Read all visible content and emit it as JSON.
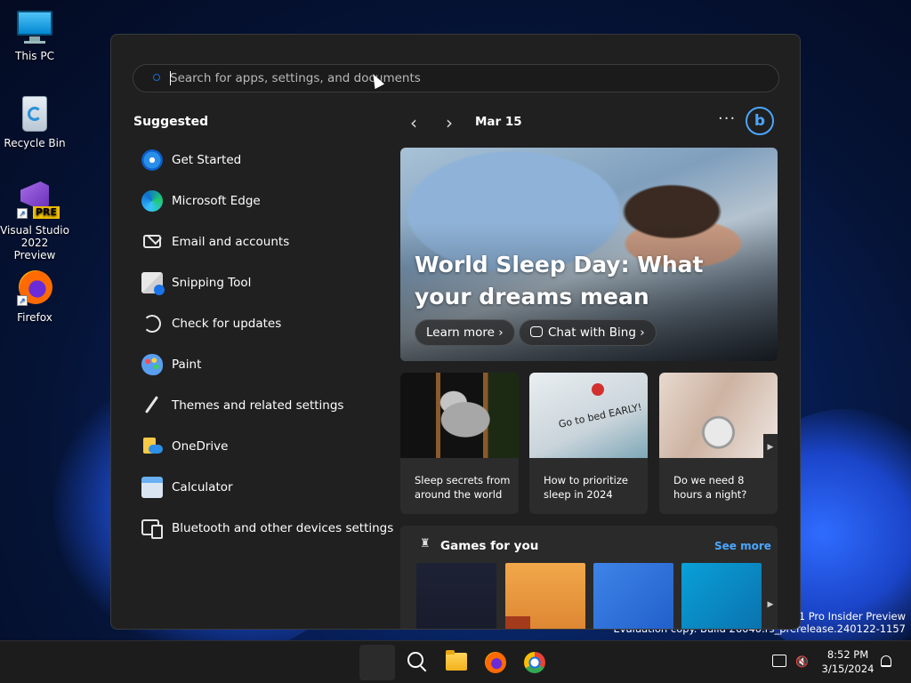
{
  "desktop": {
    "icons": [
      {
        "label": "This PC"
      },
      {
        "label": "Recycle Bin"
      },
      {
        "label": "Visual Studio 2022 Preview",
        "badge": "PRE"
      },
      {
        "label": "Firefox"
      }
    ],
    "watermark": {
      "line1": "s 11 Pro Insider Preview",
      "line2": "Evaluation copy. Build 26040.rs_prerelease.240122-1157"
    }
  },
  "start_menu": {
    "search": {
      "placeholder": "Search for apps, settings, and documents",
      "value": ""
    },
    "suggested": {
      "title": "Suggested",
      "items": [
        {
          "label": "Get Started",
          "icon": "get-started-icon"
        },
        {
          "label": "Microsoft Edge",
          "icon": "edge-icon"
        },
        {
          "label": "Email and accounts",
          "icon": "mail-icon"
        },
        {
          "label": "Snipping Tool",
          "icon": "snipping-tool-icon"
        },
        {
          "label": "Check for updates",
          "icon": "refresh-icon"
        },
        {
          "label": "Paint",
          "icon": "paint-icon"
        },
        {
          "label": "Themes and related settings",
          "icon": "brush-icon"
        },
        {
          "label": "OneDrive",
          "icon": "onedrive-icon"
        },
        {
          "label": "Calculator",
          "icon": "calculator-icon"
        },
        {
          "label": "Bluetooth and other devices settings",
          "icon": "devices-icon"
        }
      ]
    },
    "feed": {
      "prev_glyph": "‹",
      "next_glyph": "›",
      "date": "Mar 15",
      "more_glyph": "···",
      "bing_glyph": "b",
      "hero": {
        "title": "World Sleep Day: What your dreams mean",
        "learn_more": "Learn more ›",
        "chat": "Chat with Bing ›"
      },
      "cards": [
        {
          "caption": "Sleep secrets from around the world"
        },
        {
          "caption": "How to prioritize sleep in 2024",
          "note": "Go to bed EARLY!"
        },
        {
          "caption": "Do we need 8 hours a night?"
        }
      ],
      "scroll_glyph": "▶",
      "games": {
        "title": "Games for you",
        "see_more": "See more",
        "icon_glyph": "♜"
      }
    }
  },
  "taskbar": {
    "time": "8:52 PM",
    "date": "3/15/2024",
    "volume_glyph": "🔇"
  }
}
